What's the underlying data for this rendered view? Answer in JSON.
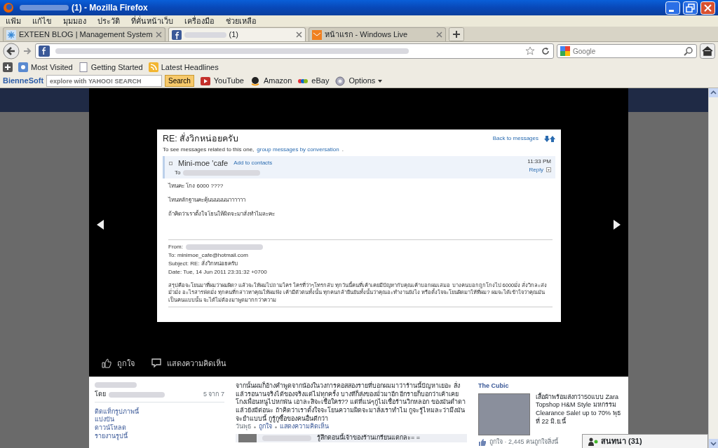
{
  "window": {
    "title": "(1) - Mozilla Firefox"
  },
  "menu": [
    "แฟ้ม",
    "แก้ไข",
    "มุมมอง",
    "ประวัติ",
    "ที่คั่นหน้าเว็บ",
    "เครื่องมือ",
    "ช่วยเหลือ"
  ],
  "tabs": [
    {
      "label": "EXTEEN BLOG | Management System",
      "selected": false
    },
    {
      "label": "(1)",
      "selected": true
    },
    {
      "label": "หน้าแรก - Windows Live",
      "selected": false
    }
  ],
  "search": {
    "placeholder": "Google"
  },
  "bookmarks": [
    "Most Visited",
    "Getting Started",
    "Latest Headlines"
  ],
  "toolbar": {
    "brand": "BienneSoft",
    "search_placeholder": "explore with YAHOO! SEARCH",
    "search_button": "Search",
    "links": [
      "YouTube",
      "Amazon",
      "eBay",
      "Options"
    ]
  },
  "email": {
    "subject": "RE: สั่งวิกหน่อยครับ",
    "back": "Back to messages",
    "hint": "To see messages related to this one,",
    "hint_link": "group messages by conversation",
    "hint_end": ".",
    "sender": "Mini-moe 'cafe",
    "add_contact": "Add to contacts",
    "to": "To",
    "time": "11:33 PM",
    "reply": "Reply",
    "body": [
      "ไหนคะ โกง 6000 ????",
      "ไหนหลักฐานคะคุ้นนนนนนาาาาาา",
      "ถ้าคิดว่าเราตั้งใจโยนให้ผิดจะมาสั่งทำไมละคะ"
    ],
    "quoted_from": "From:",
    "quoted_lines": [
      "To: minimoe_cafe@hotmail.com",
      "Subject: RE: สั่งวิกหน่อยครับ",
      "Date: Tue, 14 Jun 2011 23:31:32 +0700"
    ],
    "quoted_text": "สรุปคือจะโยนมาที่ผมว่าผมผิด? แล้วจะให้ผมไปถามใคร ใครที่ว่าๆโทรกลับ ทุกวันนี้คนที่เค้าเคยมีปัญหากับคุณเค้าบอกผมเสมอ บางคนบอกถูกโกงไป 6000มั่ง สั่งวิกละส่งมั่วมั่ง อะไรสารพัดมั่ง ทุกคนที่กล่าวหาคุณให้ผมฟัง เค้ามีตัวตนทั้งนั้น ทุกคนกล้ายืนยันทั้งนั้นว่าคุณอะทำงานยังไง หรือตั้งใจจะโยนผิดมาให้ที่ผม? ผมจะได้เข้าใจว่าคุณมันเป็นคนแบบนั้น จะได้ไม่ต้องมาพูดมากกว่าความ"
  },
  "photo_actions": [
    "ถูกใจ",
    "แสดงความคิดเห็น"
  ],
  "photo_info": {
    "by": "โดย",
    "position": "5 จาก 7",
    "links": [
      "ติดแท็กรูปภาพนี้",
      "แบ่งปัน",
      "ดาวน์โหลด",
      "รายงานรูปนี้"
    ]
  },
  "comment": {
    "text": "จากนั้นผมก็อ้างคำพูดจากน้องในวงการคอสสองรายที่บอกผมมาว่าร้านนี้ปัญหาเยอะ สั่งแล้วรอนานจริงได้ของจริงแต่ไม่ทุกครั้ง บางทีก็ส่งของมั่วมาอีก อีกรายก็บอกว่าเค้าเคยโกงเพื่อนหนูไปหกพัน เอาละสิจะเชื่อใคร?? แต่ที่แน่ๆกูไม่เชื่อร้านวิกหลอก ของมันดำดา แล้วยังมีต่อนะ ถ้าคิดว่าเราตั้งใจจะโยนความผิดจะมาสั่งเราทำไม กูจะรู้ไหมละว่ามึงมันจะยำแบบนี้ กูรู้กูซื้อของคนอื่นดีกว่า",
    "meta": [
      "วันพุธ",
      "ถูกใจ",
      "แสดงความคิดเห็น"
    ],
    "reply": "รู้สึกตอนนี้เจ้าของร้านเกรียนแตกละ= ="
  },
  "ad": {
    "title": "The Cubic",
    "text": "เสื้อผ้าพร้อมส่งกว่า50แบบ Zara Topshop H&M Style มหกรรม Clearance Sale! up to 70% พุธที่ 22 มิ.ย.นี้",
    "likes": "ถูกใจ · 2,445 คนถูกใจสิ่งนี้"
  },
  "chat": {
    "label": "สนทนา (31)"
  }
}
